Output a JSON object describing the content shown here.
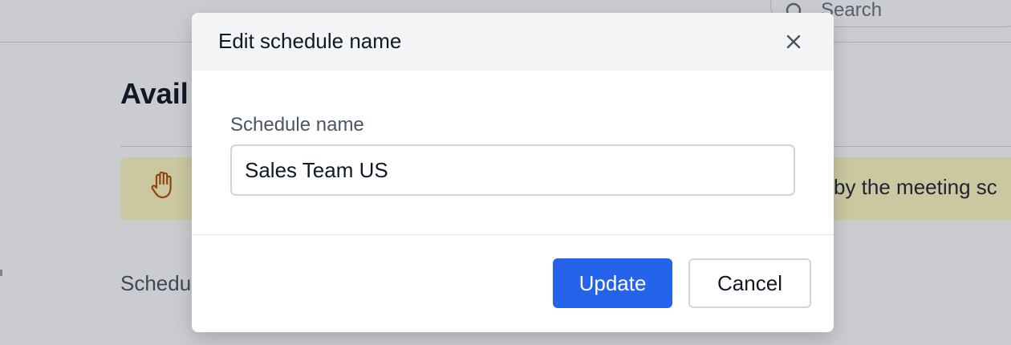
{
  "background": {
    "search_placeholder": "Search",
    "page_heading": "Avail",
    "notice_text": "by the meeting sc",
    "schedule_label": "Schedu"
  },
  "modal": {
    "title": "Edit schedule name",
    "close_icon": "close-icon",
    "field_label": "Schedule name",
    "input_value": "Sales Team US",
    "update_label": "Update",
    "cancel_label": "Cancel"
  },
  "colors": {
    "primary": "#2563eb",
    "notice_bg": "#fef9c3",
    "hand_icon": "#b45309",
    "header_bg": "#f3f4f6"
  }
}
